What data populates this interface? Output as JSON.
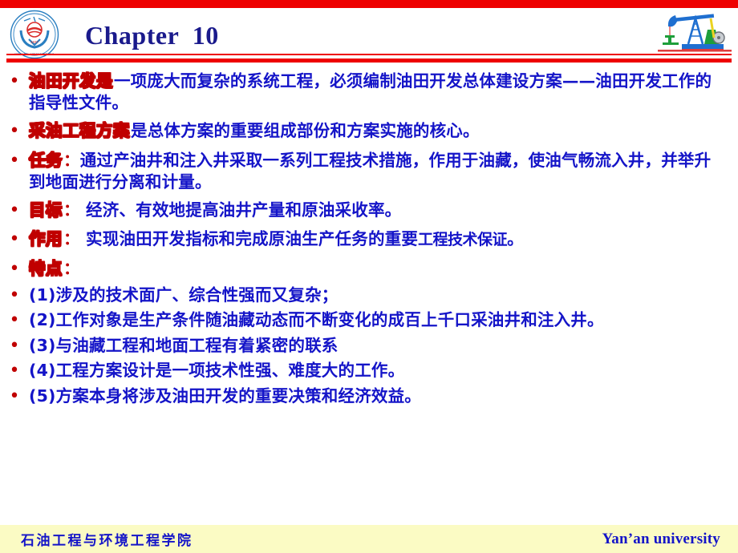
{
  "slide": {
    "title": "Chapter  10",
    "accent_red": "#ee0000",
    "title_blue": "#1a1a8c",
    "body_blue": "#1414c8",
    "emphasis_red": "#c00000",
    "footer_bg": "#fbfbc4"
  },
  "header": {
    "logo_name": "yanan-university-seal",
    "logo_text_top": "延安大学",
    "logo_text_bottom": "YAN'AN UNIVERSITY",
    "logo_year": "1937",
    "pumpjack_name": "oil-pumpjack-illustration"
  },
  "bullets": [
    {
      "marker": "•",
      "keyword": "油田开发是",
      "keyword_style": "outline",
      "colon": "",
      "rest": "一项庞大而复杂的系统工程，必须编制油田开发总体建设方案——油田开发工作的指导性文件。",
      "emphasis_tail": "",
      "tail": ""
    },
    {
      "marker": "•",
      "keyword": "采油工程方案",
      "keyword_style": "outline",
      "colon": "",
      "rest": "是总体方案的重要组成部份和方案实施的核心。",
      "emphasis_tail": "",
      "tail": ""
    },
    {
      "marker": "•",
      "keyword": "任务",
      "keyword_style": "outline",
      "colon": "：",
      "rest": "通过产油井和注入井采取一系列工程技术措施，作用于油藏，使油气畅流入井，并举升到地面进行分离和计量。",
      "emphasis_tail": "",
      "tail": ""
    },
    {
      "marker": "•",
      "keyword": "目标",
      "keyword_style": "outline",
      "colon": "：",
      "rest": " 经济、有效地提高油井产量和原油采收率。",
      "emphasis_tail": "",
      "tail": ""
    },
    {
      "marker": "•",
      "keyword": "作用",
      "keyword_style": "outline",
      "colon": "：",
      "rest": " 实现油田开发指标和完成原油生产任务的重要",
      "emphasis_tail": "工程技术保证",
      "tail": "。"
    },
    {
      "marker": "•",
      "keyword": "特点",
      "keyword_style": "outline",
      "colon": "：",
      "rest": "",
      "emphasis_tail": "",
      "tail": ""
    },
    {
      "marker": "•",
      "keyword": "(1)",
      "keyword_style": "plain",
      "colon": "",
      "rest": "涉及的技术面广、综合性强而又复杂；",
      "emphasis_tail": "",
      "tail": ""
    },
    {
      "marker": "•",
      "keyword": "(2)",
      "keyword_style": "plain",
      "colon": "",
      "rest": "工作对象是生产条件随油藏动态而不断变化的成百上千口采油井和注入井。",
      "emphasis_tail": "",
      "tail": ""
    },
    {
      "marker": "•",
      "keyword": "(3)",
      "keyword_style": "plain",
      "colon": "",
      "rest": "与油藏工程和地面工程有着紧密的联系",
      "emphasis_tail": "",
      "tail": ""
    },
    {
      "marker": "•",
      "keyword": "(4)",
      "keyword_style": "plain",
      "colon": "",
      "rest": "工程方案设计是一项技术性强、难度大的工作。",
      "emphasis_tail": "",
      "tail": ""
    },
    {
      "marker": "•",
      "keyword": "(5)",
      "keyword_style": "plain",
      "colon": "",
      "rest": "方案本身将涉及油田开发的重要决策和经济效益。",
      "emphasis_tail": "",
      "tail": ""
    }
  ],
  "footer": {
    "left": "石油工程与环境工程学院",
    "right": "Yan’an university"
  }
}
